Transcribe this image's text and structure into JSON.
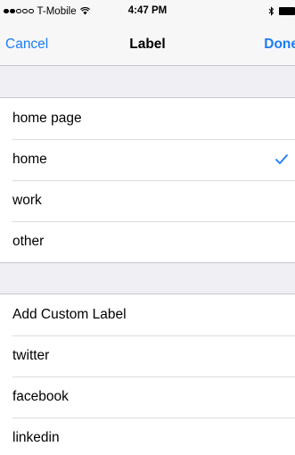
{
  "status_bar": {
    "carrier": "T-Mobile",
    "time": "4:47 PM",
    "signal_bars_filled": 2,
    "signal_bars_total": 5
  },
  "nav": {
    "cancel_label": "Cancel",
    "title": "Label",
    "done_label": "Done"
  },
  "group1": {
    "items": [
      {
        "label": "home page",
        "selected": false
      },
      {
        "label": "home",
        "selected": true
      },
      {
        "label": "work",
        "selected": false
      },
      {
        "label": "other",
        "selected": false
      }
    ]
  },
  "group2": {
    "items": [
      {
        "label": "Add Custom Label"
      },
      {
        "label": "twitter"
      },
      {
        "label": "facebook"
      },
      {
        "label": "linkedin"
      }
    ]
  },
  "colors": {
    "accent": "#1a7cf5",
    "background": "#efeff4",
    "separator": "#c8c7cc"
  },
  "icons": {
    "checkmark": "checkmark-icon",
    "wifi": "wifi-icon",
    "bluetooth": "bluetooth-icon",
    "battery": "battery-icon"
  }
}
